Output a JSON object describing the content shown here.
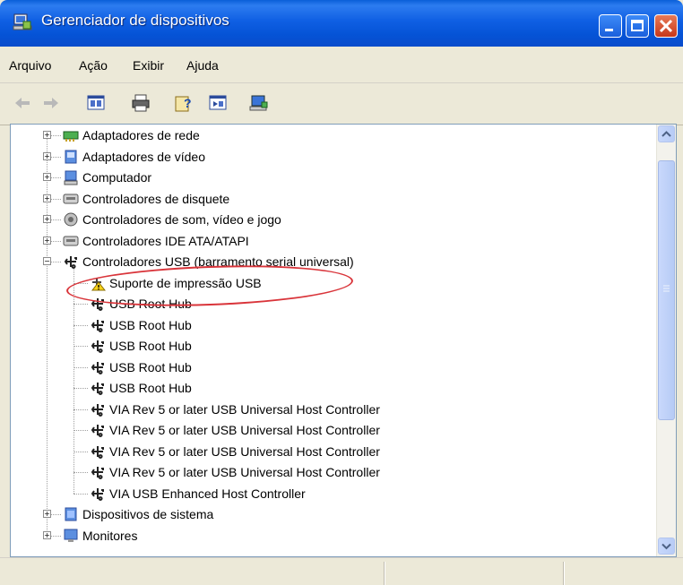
{
  "window": {
    "title": "Gerenciador de dispositivos",
    "title_icon": "device-manager-icon"
  },
  "menu": [
    "Arquivo",
    "Ação",
    "Exibir",
    "Ajuda"
  ],
  "toolbar": [
    "back-arrow-icon",
    "forward-arrow-icon",
    "properties-icon",
    "print-icon",
    "help-icon",
    "view-icon",
    "computer-icon"
  ],
  "tree": {
    "items": [
      {
        "label": "Adaptadores de rede",
        "icon": "network-adapter-icon",
        "level": 0,
        "expander": "+"
      },
      {
        "label": "Adaptadores de vídeo",
        "icon": "display-adapter-icon",
        "level": 0,
        "expander": "+"
      },
      {
        "label": "Computador",
        "icon": "computer-icon",
        "level": 0,
        "expander": "+"
      },
      {
        "label": "Controladores de disquete",
        "icon": "floppy-controller-icon",
        "level": 0,
        "expander": "+"
      },
      {
        "label": "Controladores de som, vídeo e jogo",
        "icon": "sound-icon",
        "level": 0,
        "expander": "+"
      },
      {
        "label": "Controladores IDE ATA/ATAPI",
        "icon": "ide-controller-icon",
        "level": 0,
        "expander": "+"
      },
      {
        "label": "Controladores USB (barramento serial universal)",
        "icon": "usb-icon",
        "level": 0,
        "expander": "-"
      },
      {
        "label": "Suporte de impressão USB",
        "icon": "usb-warning-icon",
        "level": 1,
        "expander": ""
      },
      {
        "label": "USB Root Hub",
        "icon": "usb-icon",
        "level": 1,
        "expander": ""
      },
      {
        "label": "USB Root Hub",
        "icon": "usb-icon",
        "level": 1,
        "expander": ""
      },
      {
        "label": "USB Root Hub",
        "icon": "usb-icon",
        "level": 1,
        "expander": ""
      },
      {
        "label": "USB Root Hub",
        "icon": "usb-icon",
        "level": 1,
        "expander": ""
      },
      {
        "label": "USB Root Hub",
        "icon": "usb-icon",
        "level": 1,
        "expander": ""
      },
      {
        "label": "VIA Rev 5 or later USB Universal Host Controller",
        "icon": "usb-icon",
        "level": 1,
        "expander": ""
      },
      {
        "label": "VIA Rev 5 or later USB Universal Host Controller",
        "icon": "usb-icon",
        "level": 1,
        "expander": ""
      },
      {
        "label": "VIA Rev 5 or later USB Universal Host Controller",
        "icon": "usb-icon",
        "level": 1,
        "expander": ""
      },
      {
        "label": "VIA Rev 5 or later USB Universal Host Controller",
        "icon": "usb-icon",
        "level": 1,
        "expander": ""
      },
      {
        "label": "VIA USB Enhanced Host Controller",
        "icon": "usb-icon",
        "level": 1,
        "expander": ""
      },
      {
        "label": "Dispositivos de sistema",
        "icon": "system-device-icon",
        "level": 0,
        "expander": "+"
      },
      {
        "label": "Monitores",
        "icon": "monitor-icon",
        "level": 0,
        "expander": "+"
      }
    ]
  },
  "colors": {
    "titlebar": "#0553d6",
    "highlight": "#d9343a",
    "panel_border": "#7f9db9"
  }
}
